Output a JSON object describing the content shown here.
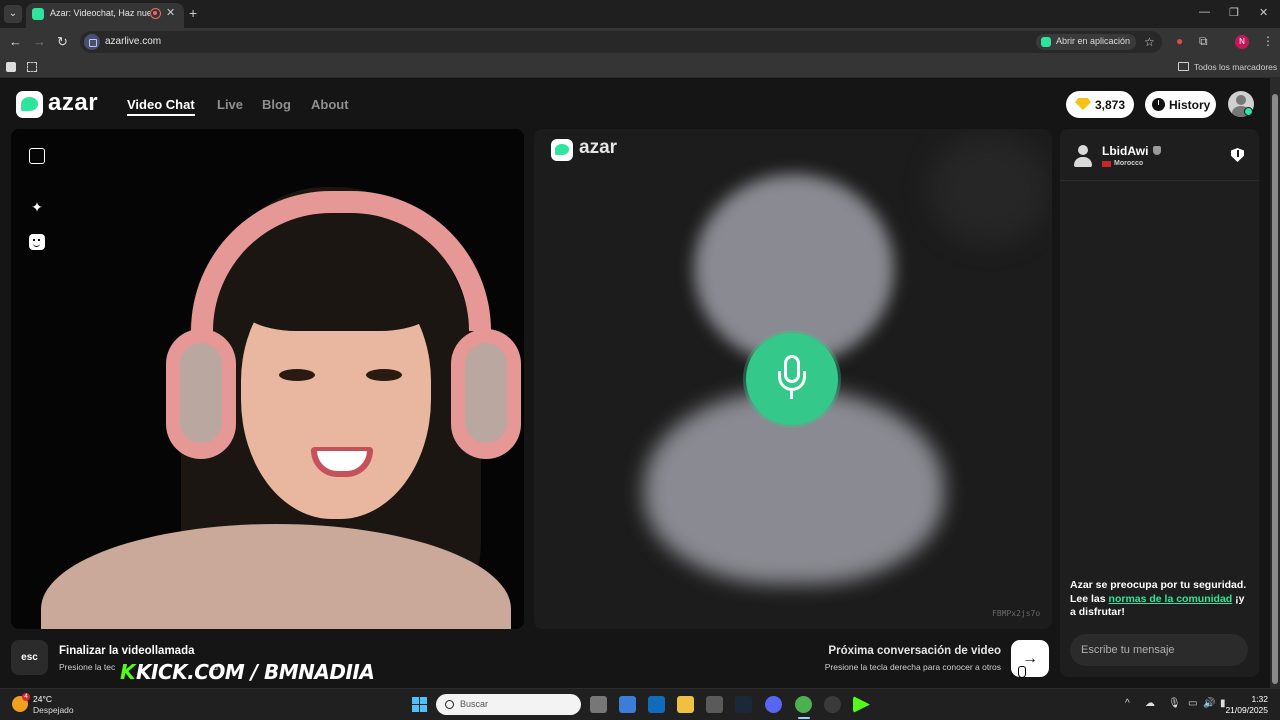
{
  "browser": {
    "tab_title": "Azar: Videochat, Haz nuevo",
    "new_tab_icon": "plus-icon",
    "url": "azarlive.com",
    "open_in_app": "Abrir en aplicación",
    "bookmarks_label": "Todos los marcadores",
    "profile_initial": "N"
  },
  "header": {
    "logo_text": "azar",
    "nav": [
      {
        "label": "Video Chat",
        "active": true
      },
      {
        "label": "Live",
        "active": false
      },
      {
        "label": "Blog",
        "active": false
      },
      {
        "label": "About",
        "active": false
      }
    ],
    "coins": "3,873",
    "history_label": "History"
  },
  "remote": {
    "logo_text": "azar",
    "session_code": "FBMPx2js7o"
  },
  "chat": {
    "partner_name": "LbidAwi",
    "partner_country": "Morocco",
    "safety_prefix": "Azar se preocupa por tu seguridad. Lee las ",
    "safety_link": "normas de la comunidad",
    "safety_suffix": " ¡y a disfrutar!",
    "input_placeholder": "Escribe tu mensaje"
  },
  "footer": {
    "esc_key": "esc",
    "end_title": "Finalizar la videollamada",
    "end_sub": "Presione la tec",
    "end_sub_tail": "d",
    "overlay_k": "K",
    "overlay_text": "KICK.COM / BMNADIIA",
    "next_title": "Próxima conversación de video",
    "next_sub": "Presione la tecla derecha para conocer a otros",
    "next_icon": "arrow-right-icon"
  },
  "taskbar": {
    "weather_temp": "24°C",
    "weather_desc": "Despejado",
    "weather_badge": "4",
    "search_placeholder": "Buscar",
    "time": "1:32",
    "date": "21/09/2025"
  },
  "colors": {
    "accent": "#2ee59d",
    "kick_green": "#53fc18",
    "page_bg": "#151515"
  }
}
